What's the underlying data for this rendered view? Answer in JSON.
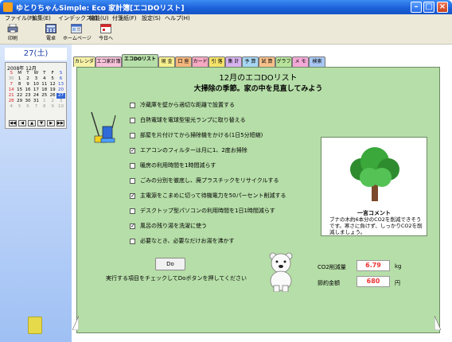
{
  "window": {
    "title": "ゆとりちゃんSimple: Eco 家計簿[エコDOリスト]"
  },
  "menu": [
    "ファイル(F)",
    "編集(E)",
    "インデックス(I)",
    "機能(U)",
    "付箋紙(F)",
    "設定(S)",
    "ヘルプ(H)"
  ],
  "toolbar": {
    "print": "印刷",
    "calc": "電卓",
    "home": "ホームページ",
    "today": "今日へ"
  },
  "sidebar": {
    "date_label": "27(土)",
    "month_label": "2008年 12月",
    "weekdays": [
      "S",
      "M",
      "T",
      "W",
      "T",
      "F",
      "S"
    ],
    "weeks": [
      [
        "30",
        "1",
        "2",
        "3",
        "4",
        "5",
        "6"
      ],
      [
        "7",
        "8",
        "9",
        "10",
        "11",
        "12",
        "13"
      ],
      [
        "14",
        "15",
        "16",
        "17",
        "18",
        "19",
        "20"
      ],
      [
        "21",
        "22",
        "23",
        "24",
        "25",
        "26",
        "27"
      ],
      [
        "28",
        "29",
        "30",
        "31",
        "1",
        "2",
        "3"
      ],
      [
        "4",
        "5",
        "6",
        "7",
        "8",
        "9",
        "10"
      ]
    ]
  },
  "tabs": [
    "カレンダ",
    "エコ家計簿",
    "エコDOリスト",
    "現 金",
    "口 座",
    "カード",
    "引 落",
    "集 計",
    "予 算",
    "試 算",
    "グラフ",
    "メ モ",
    "検索"
  ],
  "page": {
    "title": "12月のエコDOリスト",
    "subtitle": "大掃除の季節。家の中を見直してみよう",
    "items": [
      {
        "label": "冷蔵庫を壁から適切な距離で設置する",
        "checked": false
      },
      {
        "label": "白熱電球を電球型蛍光ランプに取り替える",
        "checked": false
      },
      {
        "label": "部屋を片付けてから掃除機をかける(1日5分短縮)",
        "checked": false
      },
      {
        "label": "エアコンのフィルターは月に1、2度お掃除",
        "checked": true
      },
      {
        "label": "暖房の利用時間を1時間減らす",
        "checked": false
      },
      {
        "label": "ごみの分別を徹底し、廃プラスチックをリサイクルする",
        "checked": false
      },
      {
        "label": "主電源をこまめに切って待機電力を50パーセント削減する",
        "checked": true
      },
      {
        "label": "デスクトップ型パソコンの利用時間を1日1時間減らす",
        "checked": false
      },
      {
        "label": "風呂の残り湯を洗濯に使う",
        "checked": true
      },
      {
        "label": "必要なとき、必要なだけお湯を沸かす",
        "checked": false
      }
    ],
    "comment_title": "一言コメント",
    "comment_text": "ブナの木約6本分のCO2を削減できそうです。寒さに負けず、しっかりCO2を削減しましょう。",
    "do_button": "Do",
    "do_hint": "実行する項目をチェックしてDoボタンを押してください",
    "co2_label": "CO2削減量",
    "co2_value": "6.79",
    "co2_unit": "kg",
    "saving_label": "節約金額",
    "saving_value": "680",
    "saving_unit": "円"
  },
  "colors": {
    "panel_bg": "#b6dea8",
    "value_text": "#e33333",
    "titlebar": "#1b5fd8",
    "tab_colors": [
      "#f6f2a8",
      "#f8c3da",
      "#b6dea8",
      "#f7f08f",
      "#f3b67d",
      "#f6a9c3",
      "#f4e26a",
      "#d7b3ef",
      "#a6d6f2",
      "#f7c08a",
      "#b8e39a",
      "#f3a9d8",
      "#a8c7f3"
    ]
  }
}
